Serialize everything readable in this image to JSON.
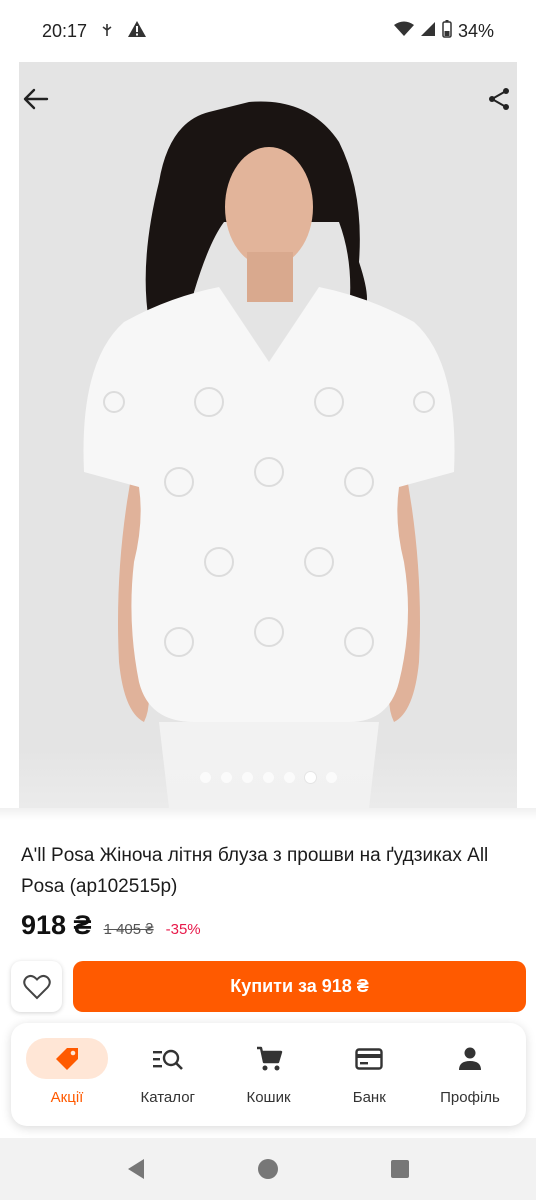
{
  "status": {
    "time": "20:17",
    "battery": "34%",
    "icons": [
      "usb-icon",
      "warning-icon",
      "wifi-icon",
      "signal-icon",
      "battery-icon"
    ]
  },
  "gallery": {
    "image_count": 7,
    "active_index": 5
  },
  "product": {
    "title": "A'll Posa Жіноча літня блуза з прошви на ґудзиках All Posa (ap102515p)",
    "price": "918 ₴",
    "old_price": "1 405 ₴",
    "discount": "-35%"
  },
  "actions": {
    "buy_label": "Купити за 918 ₴"
  },
  "tabs": [
    {
      "label": "Акції",
      "icon": "tag-icon",
      "active": true
    },
    {
      "label": "Каталог",
      "icon": "catalog-search-icon",
      "active": false
    },
    {
      "label": "Кошик",
      "icon": "cart-icon",
      "active": false
    },
    {
      "label": "Банк",
      "icon": "card-icon",
      "active": false
    },
    {
      "label": "Профіль",
      "icon": "person-icon",
      "active": false
    }
  ],
  "colors": {
    "accent": "#ff5a00",
    "discount": "#e8194a",
    "tab_active_bg": "#ffe6d6"
  }
}
